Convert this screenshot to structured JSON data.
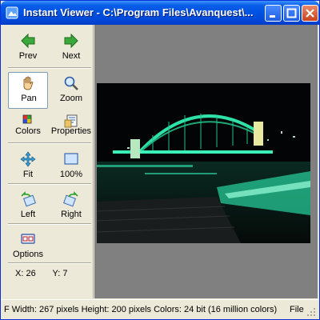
{
  "window": {
    "title": "Instant Viewer - C:\\Program Files\\Avanquest\\...",
    "title_bar_color": "#0054e3",
    "buttons": [
      "minimize-icon",
      "maximize-icon",
      "close-icon"
    ]
  },
  "toolbar": {
    "prev_label": "Prev",
    "next_label": "Next",
    "pan_label": "Pan",
    "zoom_label": "Zoom",
    "colors_label": "Colors",
    "properties_label": "Properties",
    "fit_label": "Fit",
    "actual_size_label": "100%",
    "rotate_left_label": "Left",
    "rotate_right_label": "Right",
    "options_label": "Options",
    "active_tool": "Pan"
  },
  "coords": {
    "x_text": "X: 26",
    "y_text": "Y: 7"
  },
  "image": {
    "description_icon": "harbour-bridge-night-photo"
  },
  "status": {
    "text": "F Width: 267 pixels  Height: 200 pixels  Colors: 24 bit (16 million colors)",
    "right_text": "File"
  },
  "colors": {
    "face": "#ece9d8",
    "viewer_bg": "#808080",
    "accent_green": "#2aa02a"
  }
}
